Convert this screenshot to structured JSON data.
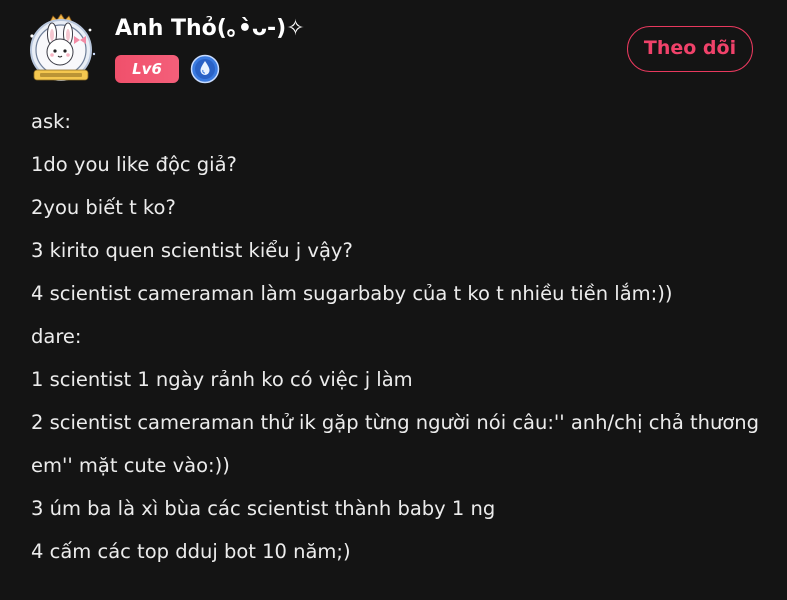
{
  "user": {
    "name": "Anh Thỏ(｡•̀ᴗ-)✧",
    "level": "Lv6",
    "avatar_icon": "bunny-avatar-icon",
    "verified_icon": "blue-droplet-badge-icon"
  },
  "follow_button": {
    "label": "Theo dõi"
  },
  "post": {
    "lines": [
      "ask:",
      "1do you like độc giả?",
      "2you biết t ko?",
      "3 kirito quen scientist kiểu j vậy?",
      "4 scientist cameraman làm sugarbaby của t ko t nhiều tiền lắm:))",
      "dare:",
      "1 scientist 1 ngày rảnh ko có việc j làm",
      "2 scientist cameraman thử ik gặp từng người nói câu:'' anh/chị chả thương em'' mặt cute vào:))",
      "3 úm ba là xì bùa các scientist thành baby 1 ng",
      "4 cấm các top dduj bot 10 năm;)"
    ]
  },
  "colors": {
    "background": "#141414",
    "text": "#ececec",
    "accent": "#f0426a",
    "level_badge": "#f0506b",
    "verified_badge": "#2f6fd6"
  }
}
